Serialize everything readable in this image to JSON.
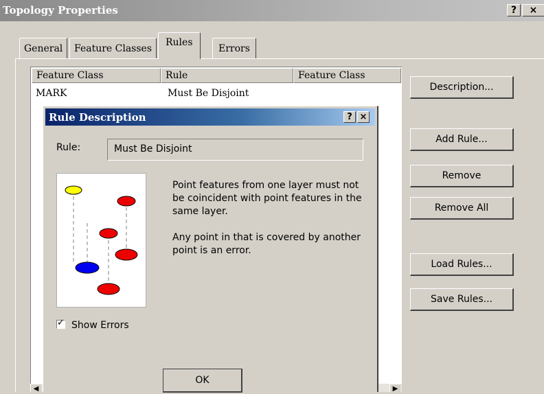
{
  "window": {
    "title": "Topology Properties",
    "help_glyph": "?",
    "close_glyph": "×"
  },
  "tabs": [
    {
      "label": "General"
    },
    {
      "label": "Feature Classes"
    },
    {
      "label": "Rules",
      "active": true
    },
    {
      "label": "Errors"
    }
  ],
  "rules_table": {
    "columns": [
      "Feature Class",
      "Rule",
      "Feature Class"
    ],
    "rows": [
      {
        "feature_class": "MARK",
        "rule": "Must Be Disjoint",
        "feature_class_2": ""
      }
    ]
  },
  "side_buttons": {
    "description": "Description...",
    "add_rule": "Add Rule...",
    "remove": "Remove",
    "remove_all": "Remove All",
    "load_rules": "Load Rules...",
    "save_rules": "Save Rules..."
  },
  "rule_dialog": {
    "title": "Rule Description",
    "help_glyph": "?",
    "close_glyph": "×",
    "rule_label": "Rule:",
    "rule_value": "Must Be Disjoint",
    "description_p1": "Point features from one layer must not be coincident with point features in the same layer.",
    "description_p2": "Any point in that is covered by another point is an error.",
    "show_errors_label": "Show Errors",
    "show_errors_checked": true,
    "ok_label": "OK"
  },
  "colors": {
    "dialog_title_bg": "#0a246a",
    "point_red": "#ee0000",
    "point_yellow": "#ffff00",
    "point_blue": "#0000ee"
  }
}
